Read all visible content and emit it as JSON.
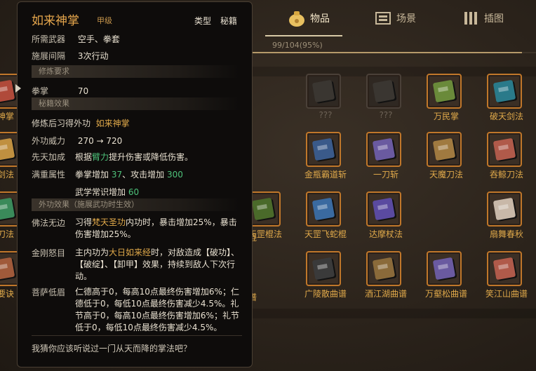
{
  "tabs": [
    {
      "label": "物品",
      "icon": "bag-icon",
      "active": true
    },
    {
      "label": "场景",
      "icon": "scene-icon",
      "active": false
    },
    {
      "label": "插图",
      "icon": "illustration-icon",
      "active": false
    }
  ],
  "progress": {
    "text": "99/104(95%)",
    "fraction": 0.95
  },
  "tooltip": {
    "name": "如来神掌",
    "grade": "甲级",
    "type_label": "类型",
    "type_value": "秘籍",
    "weapon_label": "所需武器",
    "weapon_value": "空手、拳套",
    "interval_label": "施展间隔",
    "interval_value": "3次行动",
    "req_section": "修炼要求",
    "req_label": "拳掌",
    "req_value": "70",
    "effect_section": "秘籍效果",
    "learn_label": "修炼后习得外功",
    "learn_value": "如来神掌",
    "power_label": "外功威力",
    "power_value": "270 → 720",
    "innate_label": "先天加成",
    "innate_pre": "根据",
    "innate_attr": "臂力",
    "innate_post": "提升伤害或降低伤害。",
    "full_label": "满重属性",
    "full_line1_pre": "拳掌增加 ",
    "full_line1_v1": "37",
    "full_line1_mid": "、攻击增加 ",
    "full_line1_v2": "300",
    "full_line2_pre": "武学常识增加 ",
    "full_line2_v": "60",
    "ext_section": "外功效果（施展武功时生效）",
    "buddha_label": "佛法无边",
    "buddha_pre": "习得",
    "buddha_skill": "梵天圣功",
    "buddha_post": "内功时，暴击增加25%，暴击伤害增加25%。",
    "vajra_label": "金刚怒目",
    "vajra_pre": "主内功为",
    "vajra_skill": "大日如来经",
    "vajra_post": "时，对敌造成【破功】、【破绽】、【卸甲】效果，持续到敌人下次行动。",
    "bodhi_label": "菩萨低眉",
    "bodhi_text": "仁德高于0，每高10点最终伤害增加6%；仁德低于0，每低10点最终伤害减少4.5%。礼节高于0，每高10点最终伤害增加6%；礼节低于0，每低10点最终伤害减少4.5%。",
    "footer": "我猜你应该听说过一门从天而降的掌法吧？"
  },
  "items": [
    {
      "label": "神掌",
      "color": "#b04a3a",
      "locked": false
    },
    {
      "label": "???",
      "color": "#444",
      "locked": true
    },
    {
      "label": "???",
      "color": "#444",
      "locked": true
    },
    {
      "label": "万民掌",
      "color": "#6a8a3a",
      "locked": false
    },
    {
      "label": "破天剑法",
      "color": "#2a7a8a",
      "locked": false
    },
    {
      "label": "剑法",
      "color": "#c09040",
      "locked": false
    },
    {
      "label": "金瓶霸道斩",
      "color": "#3a5a8a",
      "locked": false
    },
    {
      "label": "一刀斩",
      "color": "#6a5aa0",
      "locked": false
    },
    {
      "label": "天魔刀法",
      "color": "#a07a40",
      "locked": false
    },
    {
      "label": "吞鲸刀法",
      "color": "#b05a4a",
      "locked": false
    },
    {
      "label": "刀法",
      "color": "#3a8a5a",
      "locked": false
    },
    {
      "label": "天罡棍法",
      "color": "#4a6a2a",
      "locked": false
    },
    {
      "label": "天罡飞蛇棍",
      "color": "#3a6aa0",
      "locked": false
    },
    {
      "label": "达摩杖法",
      "color": "#5a4aa0",
      "locked": false
    },
    {
      "label": "扇舞春秋",
      "color": "#c8b8a8",
      "locked": false
    },
    {
      "label": "要诀",
      "color": "#a05a3a",
      "locked": false
    },
    {
      "label": "广陵散曲谱",
      "color": "#3a3a3a",
      "locked": false
    },
    {
      "label": "酒江湖曲谱",
      "color": "#8a6a3a",
      "locked": false
    },
    {
      "label": "万壑松曲谱",
      "color": "#6a5aa0",
      "locked": false
    },
    {
      "label": "笑江山曲谱",
      "color": "#b05a4a",
      "locked": false
    }
  ],
  "hidden_labels": [
    "棍",
    "谱"
  ]
}
